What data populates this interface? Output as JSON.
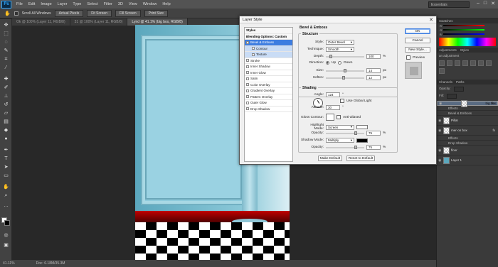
{
  "menu": {
    "items": [
      "File",
      "Edit",
      "Image",
      "Layer",
      "Type",
      "Select",
      "Filter",
      "3D",
      "View",
      "Window",
      "Help"
    ]
  },
  "options": {
    "scroll_all": "Scroll All Windows",
    "buttons": [
      "Actual Pixels",
      "Fit Screen",
      "Fill Screen",
      "Print Size"
    ],
    "workspace": "Essentials"
  },
  "tabs": [
    "Ok @ 100% (Layer 11, RGB/8)",
    "31 @ 100% (Layer 11, RGB/8)",
    "Lynd @ 41.1% (big box, RGB/8)"
  ],
  "status": {
    "zoom": "41.11%",
    "doc": "Doc: 6.18M/35.3M"
  },
  "right": {
    "panel_tabs": [
      "Swatches"
    ],
    "adj_tabs": [
      "Adjustments",
      "Styles"
    ],
    "adj_hint": "an adjustment",
    "layer_tabs": [
      "Channels",
      "Paths"
    ],
    "opacity_label": "Opacity:",
    "fill_label": "Fill:",
    "layers": [
      {
        "name": "big box",
        "sel": true
      },
      {
        "name": "Effects",
        "sub": true
      },
      {
        "name": "Bevel & Emboss",
        "sub": true
      },
      {
        "name": "Pillar"
      },
      {
        "name": "mer-on box"
      },
      {
        "name": "Effects",
        "sub": true
      },
      {
        "name": "Drop Shadow",
        "sub": true
      },
      {
        "name": "floor"
      },
      {
        "name": "Layer 1"
      }
    ]
  },
  "dialog": {
    "title": "Layer Style",
    "styles": [
      {
        "label": "Styles",
        "kind": "hdr"
      },
      {
        "label": "Blending Options: Custom",
        "kind": "hdr"
      },
      {
        "label": "Bevel & Emboss",
        "kind": "active"
      },
      {
        "label": "Contour",
        "kind": "subact"
      },
      {
        "label": "Texture",
        "kind": "subact"
      },
      {
        "label": "Stroke"
      },
      {
        "label": "Inner Shadow"
      },
      {
        "label": "Inner Glow"
      },
      {
        "label": "Satin"
      },
      {
        "label": "Color Overlay"
      },
      {
        "label": "Gradient Overlay"
      },
      {
        "label": "Pattern Overlay"
      },
      {
        "label": "Outer Glow"
      },
      {
        "label": "Drop Shadow"
      }
    ],
    "section": "Bevel & Emboss",
    "structure": "Structure",
    "style_label": "Style:",
    "style_value": "Outer Bevel",
    "technique_label": "Technique:",
    "technique_value": "Smooth",
    "depth_label": "Depth:",
    "depth_value": "100",
    "depth_level": 0.1,
    "direction_label": "Direction:",
    "up_label": "Up",
    "down_label": "Down",
    "size_label": "Size:",
    "size_value": "14",
    "size_level": 0.5,
    "soften_label": "Soften:",
    "soften_value": "12",
    "soften_level": 0.45,
    "shading": "Shading",
    "angle_label": "Angle:",
    "angle_value": "124",
    "global_light": "Use Global Light",
    "altitude_label": "Altitude:",
    "altitude_value": "30",
    "gloss_label": "Gloss Contour:",
    "anti_aliased": "Anti-aliased",
    "highlight_label": "Highlight Mode:",
    "highlight_value": "Screen",
    "hl_opacity_label": "Opacity:",
    "hl_opacity_value": "75",
    "shadow_label": "Shadow Mode:",
    "shadow_value": "Multiply",
    "sh_opacity_label": "Opacity:",
    "sh_opacity_value": "75",
    "make_default": "Make Default",
    "reset_default": "Reset to Default",
    "ok": "OK",
    "cancel": "Cancel",
    "new_style": "New Style...",
    "preview": "Preview",
    "px": "px",
    "pct": "%",
    "deg": "°"
  }
}
